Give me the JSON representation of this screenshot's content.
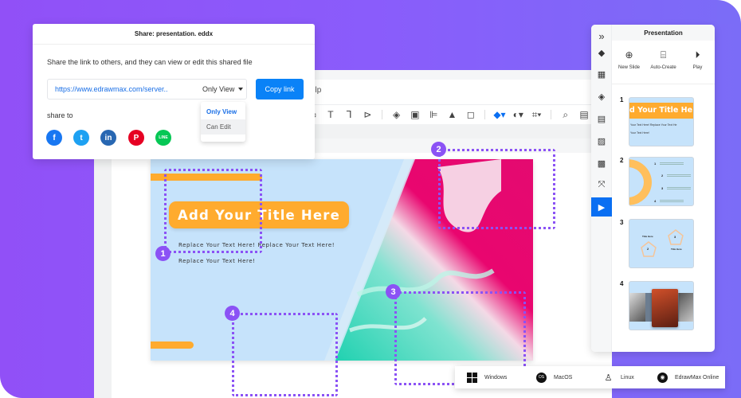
{
  "share_dialog": {
    "title": "Share: presentation. eddx",
    "description": "Share the link to others, and they can view or edit this shared file",
    "link_url": "https://www.edrawmax.com/server..",
    "permission": "Only View",
    "copy_label": "Copy link",
    "share_to_label": "share to",
    "permission_options": [
      {
        "label": "Only View",
        "selected": true
      },
      {
        "label": "Can Edit",
        "selected": false
      }
    ],
    "social": [
      {
        "name": "facebook",
        "glyph": "f",
        "color": "#1877f2"
      },
      {
        "name": "twitter",
        "glyph": "t",
        "color": "#1da1f2"
      },
      {
        "name": "linkedin",
        "glyph": "in",
        "color": "#2867b2"
      },
      {
        "name": "pinterest",
        "glyph": "P",
        "color": "#e60023"
      },
      {
        "name": "line",
        "glyph": "LINE",
        "color": "#06c755"
      }
    ]
  },
  "editor": {
    "menu_partial": "elp"
  },
  "slide": {
    "title": "Add Your Title Here",
    "text_line_1": "Replace Your Text Here! Replace Your Text Here!",
    "text_line_2": "Replace Your Text Here!"
  },
  "callouts": [
    {
      "number": "1"
    },
    {
      "number": "2"
    },
    {
      "number": "3"
    },
    {
      "number": "4"
    }
  ],
  "presentation_panel": {
    "title": "Presentation",
    "collapse_glyph": "»",
    "actions": [
      {
        "label": "New Slide",
        "icon": "plus-circle-icon"
      },
      {
        "label": "Auto-Create",
        "icon": "easel-icon"
      },
      {
        "label": "Play",
        "icon": "play-circle-icon"
      }
    ],
    "thumbnails": [
      {
        "number": "1",
        "title": "d Your Title He",
        "line1": "Your Text Here! Replace Your Text He",
        "line2": "Your Text Here!"
      },
      {
        "number": "2",
        "steps": [
          "1",
          "2",
          "3",
          "4"
        ]
      },
      {
        "number": "3",
        "shapes": [
          "2",
          "3"
        ],
        "caption": "Title Here"
      },
      {
        "number": "4"
      }
    ],
    "active_rail_item": "presentation"
  },
  "os_bar": [
    {
      "label": "Windows",
      "icon": "windows-icon"
    },
    {
      "label": "MacOS",
      "icon": "macos-icon"
    },
    {
      "label": "Linux",
      "icon": "linux-icon"
    },
    {
      "label": "EdrawMax Online",
      "icon": "chrome-icon"
    }
  ],
  "colors": {
    "accent": "#8b52f5",
    "primary": "#0a82f7",
    "slide_orange": "#ffab2e",
    "slide_blue": "#c6e3fb",
    "marble_pink": "#e9066f",
    "marble_teal": "#1fd1b0"
  }
}
